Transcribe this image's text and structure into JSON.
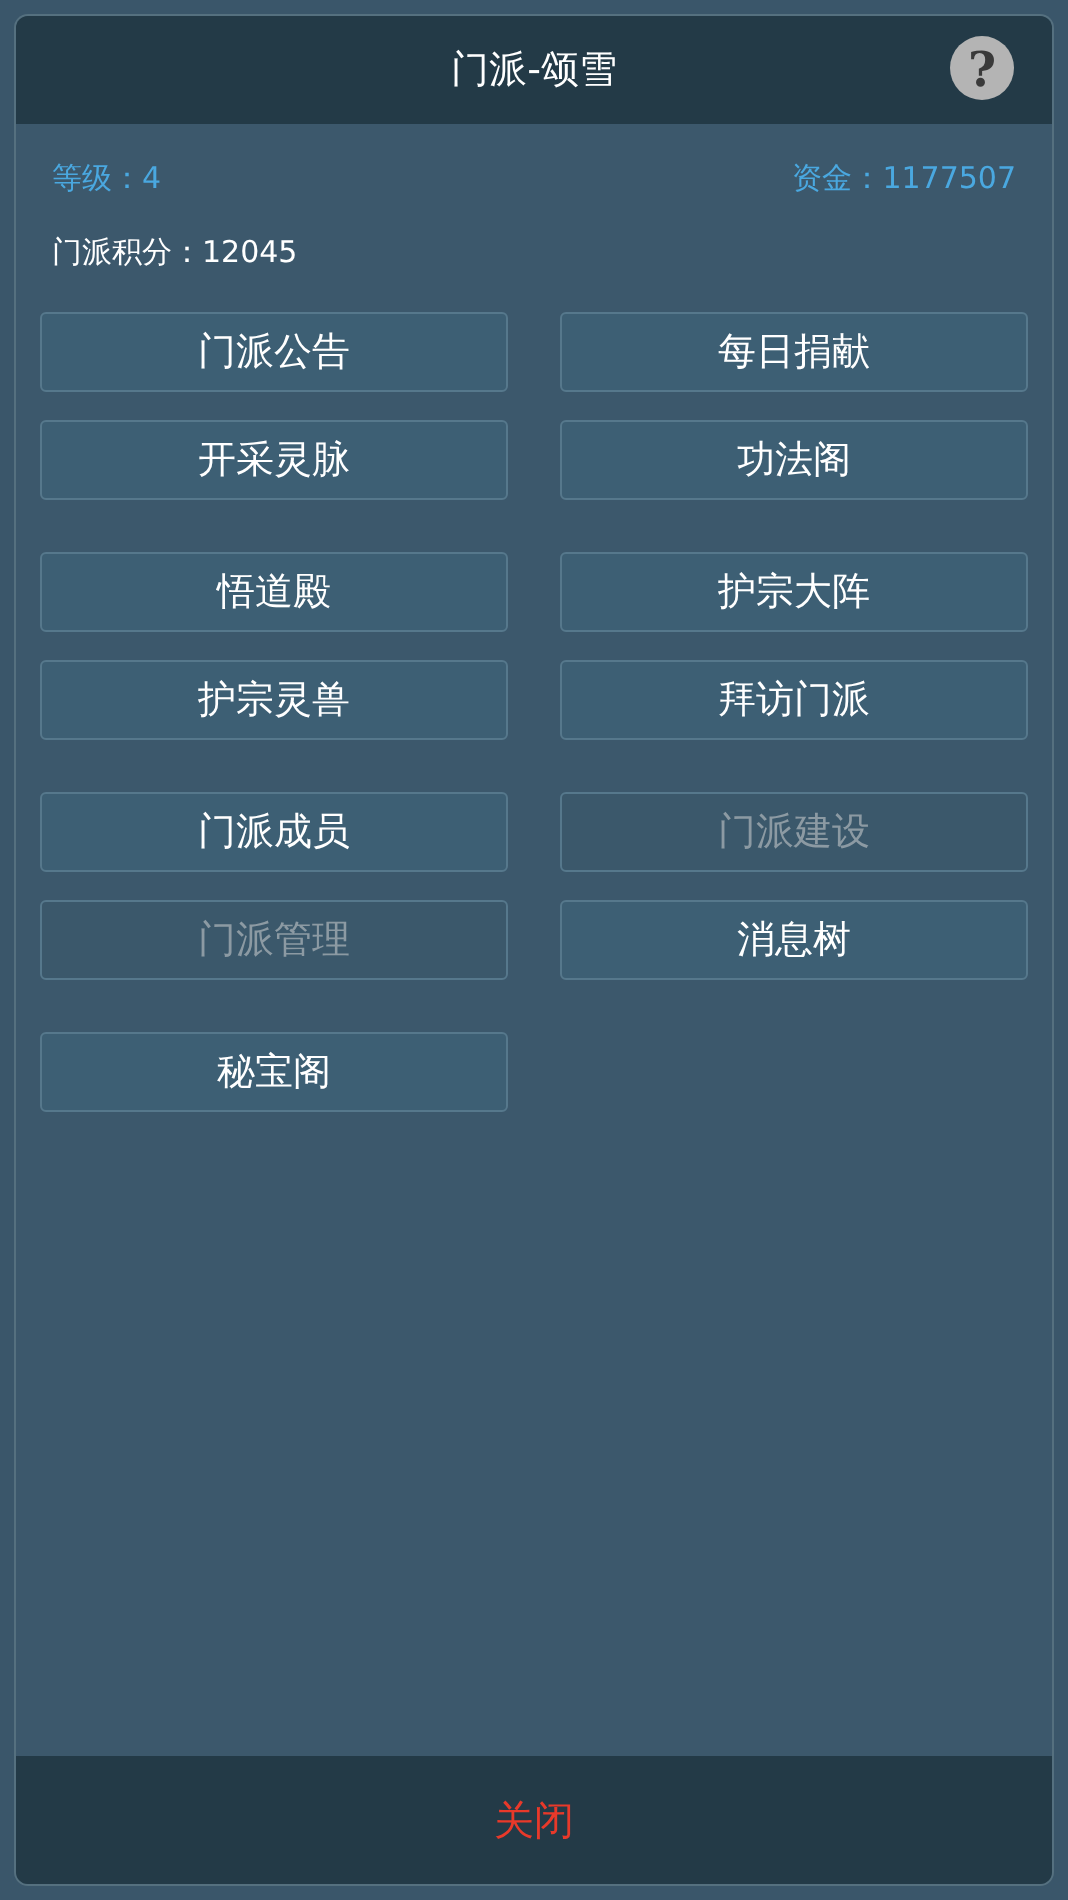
{
  "dialog": {
    "title": "门派-颂雪",
    "help_icon": "?",
    "level": "等级：4",
    "funds": "资金：1177507",
    "points": "门派积分：12045",
    "button_groups": [
      [
        {
          "label": "门派公告",
          "disabled": false
        },
        {
          "label": "每日捐献",
          "disabled": false
        },
        {
          "label": "开采灵脉",
          "disabled": false
        },
        {
          "label": "功法阁",
          "disabled": false
        }
      ],
      [
        {
          "label": "悟道殿",
          "disabled": false
        },
        {
          "label": "护宗大阵",
          "disabled": false
        },
        {
          "label": "护宗灵兽",
          "disabled": false
        },
        {
          "label": "拜访门派",
          "disabled": false
        }
      ],
      [
        {
          "label": "门派成员",
          "disabled": false
        },
        {
          "label": "门派建设",
          "disabled": true
        },
        {
          "label": "门派管理",
          "disabled": true
        },
        {
          "label": "消息树",
          "disabled": false
        }
      ],
      [
        {
          "label": "秘宝阁",
          "disabled": false
        }
      ]
    ],
    "close": "关闭"
  }
}
